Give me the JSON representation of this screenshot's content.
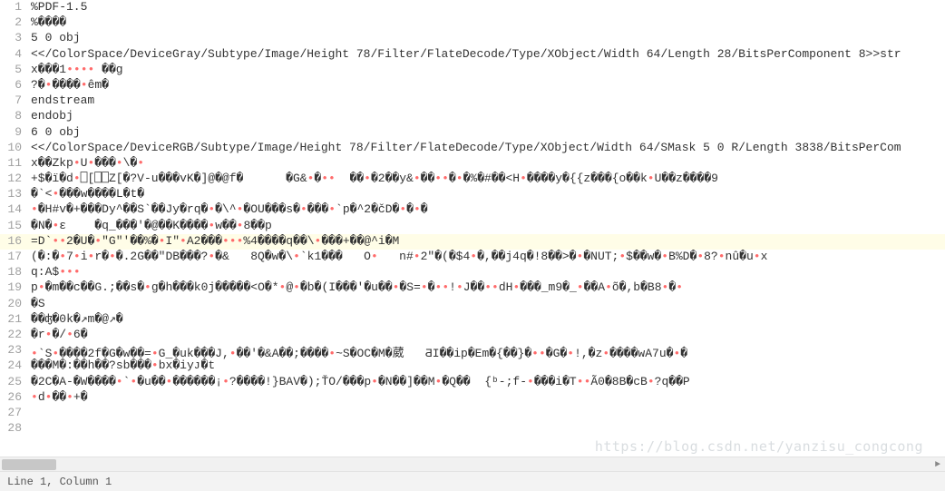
{
  "editor": {
    "lines": [
      {
        "n": 1,
        "text": "%PDF-1.5"
      },
      {
        "n": 2,
        "text": "%����"
      },
      {
        "n": 3,
        "text": "5 0 obj"
      },
      {
        "n": 4,
        "text": "<</ColorSpace/DeviceGray/Subtype/Image/Height 78/Filter/FlateDecode/Type/XObject/Width 64/Length 28/BitsPerComponent 8>>str"
      },
      {
        "n": 5,
        "text": "x���1•••• ��g"
      },
      {
        "n": 6,
        "text": "?�•����•êm�"
      },
      {
        "n": 7,
        "text": "endstream"
      },
      {
        "n": 8,
        "text": "endobj"
      },
      {
        "n": 9,
        "text": "6 0 obj"
      },
      {
        "n": 10,
        "text": "<</ColorSpace/DeviceRGB/Subtype/Image/Height 78/Filter/FlateDecode/Type/XObject/Width 64/SMask 5 0 R/Length 3838/BitsPerCom"
      },
      {
        "n": 11,
        "text": "x��Zkp•U•���•\\�•"
      },
      {
        "n": 12,
        "text": "+$�ï�d•⎕[⎕⎕Z[�?V-u���vK�]@�@f�      �G&•�••  ��•�2��y&•��••�•�%�#��<H•����y�{{z���{o��k•U��z����9"
      },
      {
        "n": 13,
        "text": "�`<•���w����L�t�"
      },
      {
        "n": 14,
        "text": "•�H#v�+���Dy^��S`��Jy�rq�•�\\^•�OU���s�•���•`p�^2�čD�•�•�"
      },
      {
        "n": 15,
        "text": "�N�•ε    �q_���'�@��K����•w��•8��p"
      },
      {
        "n": 16,
        "text": "=D`••2�U�•\"G\"'��%�•I\"•A2���•••%4����q��\\•���+��@^i�M",
        "hl": true
      },
      {
        "n": 17,
        "text": "(�:�•7•i•r�•�.2G��\"DB���?•�&   8Q�w�\\•`k1���   O•   n#•2\"�(�$4•�,��j4q�!8��>�•�NUT;•$��w�•B%D�•8?•nû�u•x"
      },
      {
        "n": 18,
        "text": "q:A$•••"
      },
      {
        "n": 19,
        "text": "p•�m��c��G.;��s�•g�h���k0j�����<O�*•@•�b�(I���'�u��•�S=•�••!•J��••dH•���_m9�_•��A•õ�,b�B8•�•"
      },
      {
        "n": 20,
        "text": "�S"
      },
      {
        "n": 21,
        "text": "��ʤ�0k�↗m�@↗�"
      },
      {
        "n": 22,
        "text": "�r•�/•6�"
      },
      {
        "n": 23,
        "text": "•`S•����2f�G�w��=•G_�uk���J,•��'�&A��;����•~S�OC�M�葳   ƋI��ip�Em�{��}�••�G�•!,�z•����wA7u�•�"
      },
      {
        "n": 24,
        "text": "���M�:��h��?sb���•bx�iyᴊ�t"
      },
      {
        "n": 25,
        "text": "�2C�A-�W����•`•�u��•������¡•?����!}BAV�);ŤO/���p•�N��]��M•�Q��  {ᵇ-;f-•���i�T••Ã0�8B�cB•?q��P"
      },
      {
        "n": 26,
        "text": "•d•��•+�"
      },
      {
        "n": 27,
        "text": ""
      },
      {
        "n": 28,
        "text": ""
      }
    ]
  },
  "statusbar": {
    "position": "Line 1, Column 1"
  },
  "watermark": "https://blog.csdn.net/yanzisu_congcong"
}
